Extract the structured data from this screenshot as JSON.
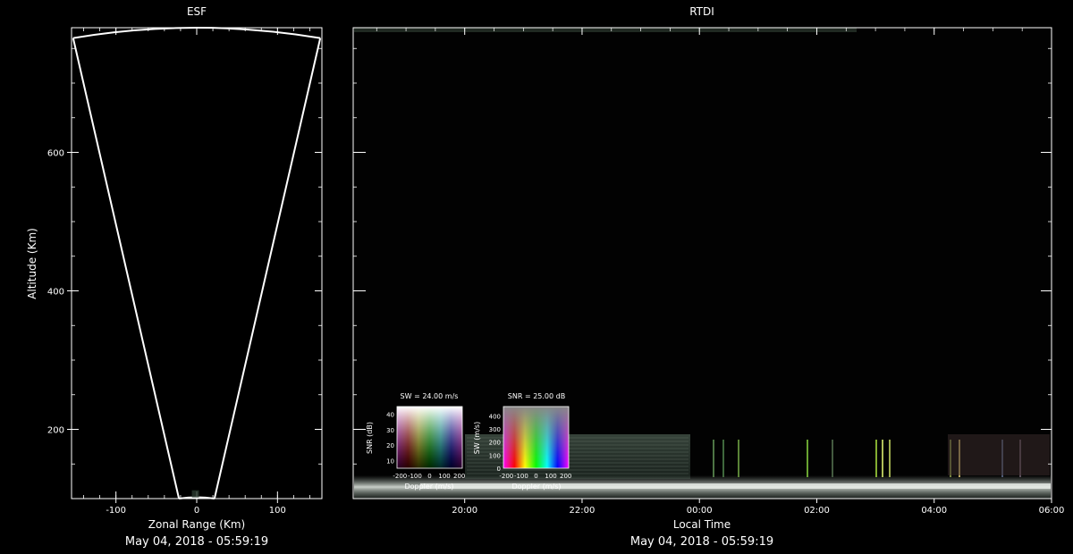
{
  "colors": {
    "background": "#000000",
    "foreground": "#ffffff"
  },
  "chart_data": [
    {
      "type": "scatter",
      "title": "ESF",
      "xlabel": "Zonal Range (Km)",
      "ylabel": "Altitude (Km)",
      "xlim": [
        -155,
        155
      ],
      "ylim": [
        100,
        780
      ],
      "x_ticks": [
        -100,
        0,
        100
      ],
      "x_tick_labels": [
        "-100",
        "0",
        "100"
      ],
      "y_ticks": [
        200,
        400,
        600
      ],
      "y_tick_labels": [
        "200",
        "400",
        "600"
      ],
      "x_minor_step": 20,
      "y_minor_step": 50,
      "beam_outline": {
        "left_edge": [
          [
            -22,
            100
          ],
          [
            -153,
            765
          ]
        ],
        "right_edge": [
          [
            22,
            100
          ],
          [
            153,
            765
          ]
        ],
        "top_arc_apex": [
          0,
          780
        ]
      },
      "date_label": "May 04, 2018 - 05:59:19"
    },
    {
      "type": "heatmap",
      "title": "RTDI",
      "xlabel": "Local Time",
      "ylabel": "",
      "x_tick_labels": [
        "20:00",
        "22:00",
        "00:00",
        "02:00",
        "04:00",
        "06:00"
      ],
      "x_tick_hours": [
        20,
        22,
        24,
        26,
        28,
        30
      ],
      "xlim_hours": [
        18.1,
        30
      ],
      "ylim": [
        100,
        780
      ],
      "y_ticks": [
        200,
        400,
        600
      ],
      "y_minor_step": 50,
      "date_label": "May 04, 2018 - 05:59:19",
      "insets": [
        {
          "title": "SW = 24.00 m/s",
          "xlabel": "Doppler (m/s)",
          "ylabel": "SNR (dB)",
          "x_tick_labels": [
            "-200",
            "-100",
            "0",
            "100",
            "200"
          ],
          "x_ticks": [
            -200,
            -100,
            0,
            100,
            200
          ],
          "xlim": [
            -220,
            220
          ],
          "y_tick_labels": [
            "10",
            "20",
            "30",
            "40"
          ],
          "y_ticks": [
            10,
            20,
            30,
            40
          ],
          "ylim": [
            5,
            45
          ]
        },
        {
          "title": "SNR = 25.00 dB",
          "xlabel": "Doppler (m/s)",
          "ylabel": "SW (m/s)",
          "x_tick_labels": [
            "-200",
            "-100",
            "0",
            "100",
            "200"
          ],
          "x_ticks": [
            -200,
            -100,
            0,
            100,
            200
          ],
          "xlim": [
            -220,
            220
          ],
          "y_tick_labels": [
            "0",
            "100",
            "200",
            "300",
            "400"
          ],
          "y_ticks": [
            0,
            100,
            200,
            300,
            400
          ],
          "ylim": [
            0,
            470
          ]
        }
      ]
    }
  ]
}
